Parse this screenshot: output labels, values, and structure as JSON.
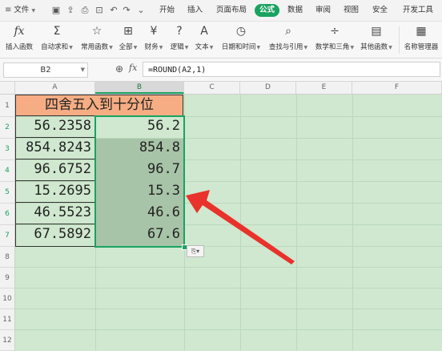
{
  "menubar": {
    "file": "文件",
    "tabs": [
      "开始",
      "插入",
      "页面布局",
      "公式",
      "数据",
      "审阅",
      "视图",
      "安全",
      "开发工具"
    ],
    "active_tab": "公式"
  },
  "ribbon": {
    "insert_function": "插入函数",
    "autosum": "自动求和",
    "common": "常用函数",
    "all": "全部",
    "finance": "财务",
    "logic": "逻辑",
    "text": "文本",
    "datetime": "日期和时间",
    "lookup": "查找与引用",
    "math": "数学和三角",
    "other": "其他函数",
    "name_manager": "名称管理器"
  },
  "formula_bar": {
    "name_box": "B2",
    "fx": "fx",
    "formula": "=ROUND(A2,1)"
  },
  "columns": [
    "A",
    "B",
    "C",
    "D",
    "E",
    "F"
  ],
  "rows": [
    "1",
    "2",
    "3",
    "4",
    "5",
    "6",
    "7",
    "8",
    "9",
    "10",
    "11",
    "12"
  ],
  "sheet": {
    "title": "四舍五入到十分位",
    "a_values": [
      "56.2358",
      "854.8243",
      "96.6752",
      "15.2695",
      "46.5523",
      "67.5892"
    ],
    "b_values": [
      "56.2",
      "854.8",
      "96.7",
      "15.3",
      "46.6",
      "67.6"
    ]
  },
  "colors": {
    "accent": "#1aa260",
    "sheet_bg": "#cfe8cf",
    "title_fill": "#f6ad83",
    "arrow": "#e8322b"
  }
}
